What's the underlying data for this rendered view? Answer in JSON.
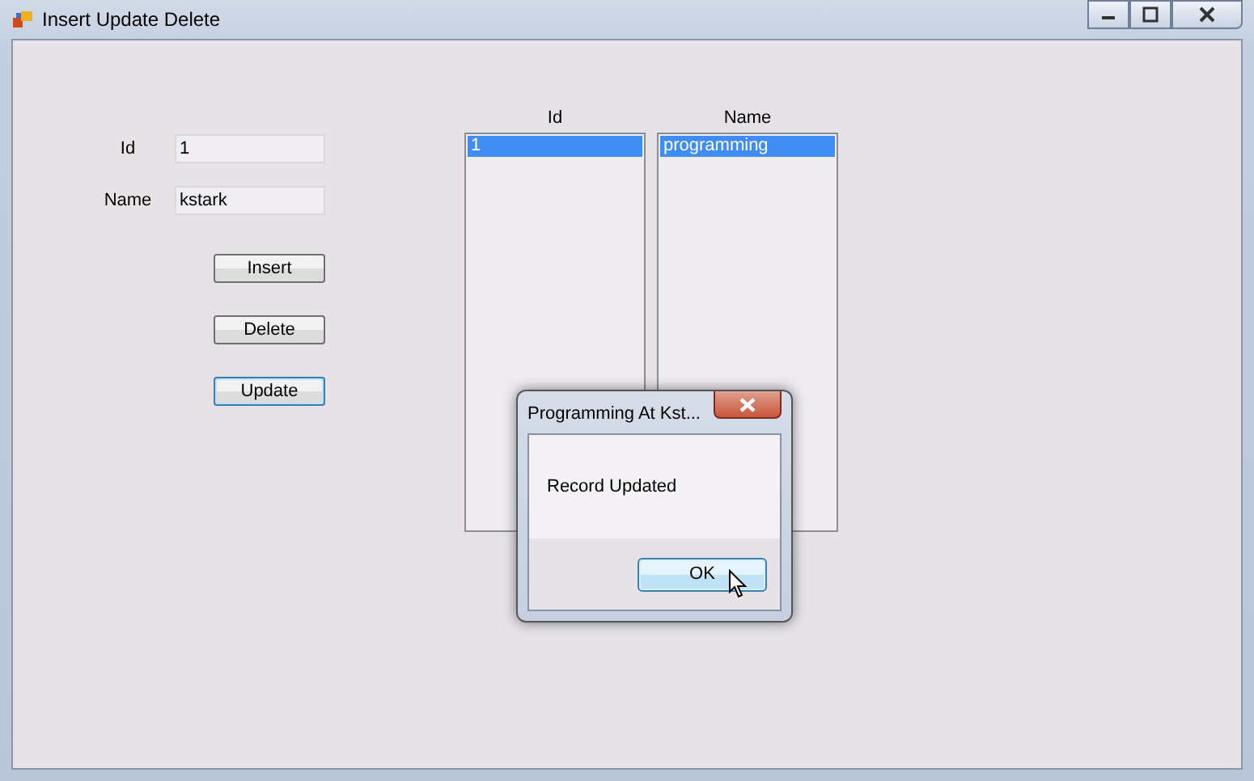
{
  "window": {
    "title": "Insert Update Delete"
  },
  "form": {
    "fields": [
      {
        "label": "Id",
        "value": "1"
      },
      {
        "label": "Name",
        "value": "kstark"
      }
    ],
    "buttons": [
      {
        "label": "Insert",
        "focused": false
      },
      {
        "label": "Delete",
        "focused": false
      },
      {
        "label": "Update",
        "focused": true
      }
    ]
  },
  "lists": [
    {
      "header": "Id",
      "items": [
        {
          "text": "1",
          "selected": true
        }
      ]
    },
    {
      "header": "Name",
      "items": [
        {
          "text": "programming",
          "selected": true
        }
      ]
    }
  ],
  "dialog": {
    "title": "Programming At Kst...",
    "message": "Record Updated",
    "buttons": [
      {
        "label": "OK",
        "focused": true
      }
    ]
  }
}
